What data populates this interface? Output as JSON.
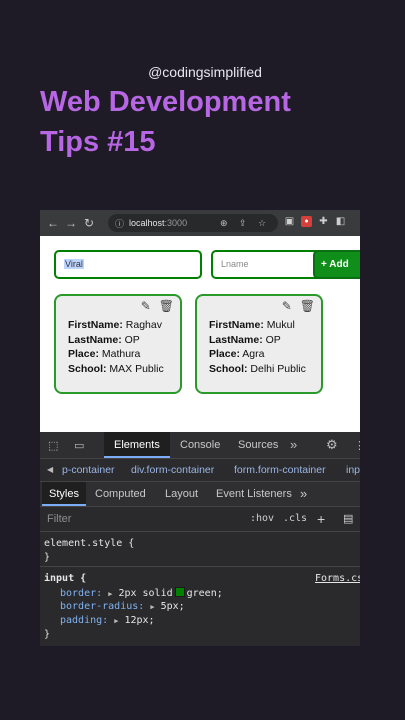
{
  "overlay": {
    "handle": "@codingsimplified",
    "title_line1": "Web Development",
    "title_line2": "Tips #15"
  },
  "browser": {
    "url_host": "localhost",
    "url_port": ":3000"
  },
  "form": {
    "firstname_value": "Viral",
    "lastname_placeholder": "Lname",
    "add_label": "+ Add"
  },
  "cards": [
    {
      "firstname_label": "FirstName:",
      "firstname": "Raghav",
      "lastname_label": "LastName:",
      "lastname": "OP",
      "place_label": "Place:",
      "place": "Mathura",
      "school_label": "School:",
      "school": "MAX Public"
    },
    {
      "firstname_label": "FirstName:",
      "firstname": "Mukul",
      "lastname_label": "LastName:",
      "lastname": "OP",
      "place_label": "Place:",
      "place": "Agra",
      "school_label": "School:",
      "school": "Delhi Public"
    }
  ],
  "devtools": {
    "tabs": [
      "Elements",
      "Console",
      "Sources"
    ],
    "breadcrumbs": [
      "p-container",
      "div.form-container",
      "form.form-container",
      "inp"
    ],
    "subtabs": [
      "Styles",
      "Computed",
      "Layout",
      "Event Listeners"
    ],
    "filter_placeholder": "Filter",
    "hov": ":hov",
    "cls": ".cls",
    "rules": {
      "element_selector": "element.style {",
      "close": "}",
      "input_selector": "input {",
      "source": "Forms.cs",
      "border_prop": "border:",
      "border_val_a": "2px solid",
      "border_val_b": "green;",
      "radius_prop": "border-radius:",
      "radius_val": "5px;",
      "padding_prop": "padding:",
      "padding_val": "12px;"
    }
  },
  "colors": {
    "title": "#b766e4",
    "border_green": "#008000",
    "add_button": "#0f8f1a"
  }
}
